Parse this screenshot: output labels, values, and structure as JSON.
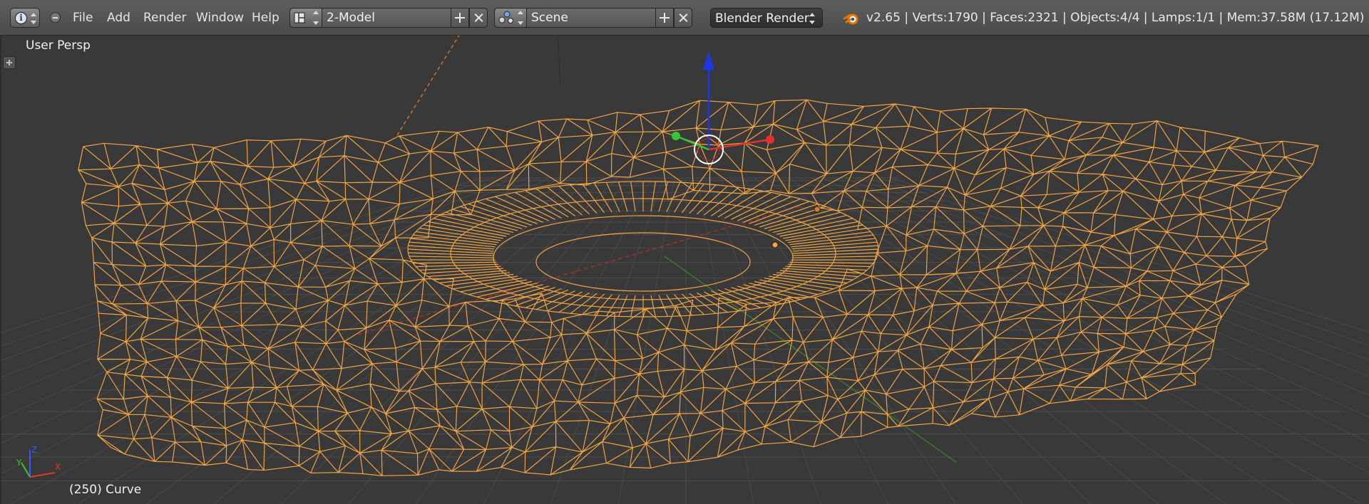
{
  "header": {
    "menus": [
      "File",
      "Add",
      "Render",
      "Window",
      "Help"
    ],
    "screen_layout": "2-Model",
    "scene": "Scene",
    "render_engine": "Blender Render",
    "stats": "v2.65 | Verts:1790 | Faces:2321 | Objects:4/4 | Lamps:1/1 | Mem:37.58M (17.12M) | Curve"
  },
  "viewport": {
    "view_name": "User Persp",
    "object_info": "(250) Curve",
    "axis_labels": {
      "x": "X",
      "y": "Y",
      "z": "Z"
    }
  },
  "icons": {
    "editor_type": "info-icon",
    "collapse": "collapse-menus-icon",
    "screen_layout": "screen-layout-icon",
    "scene": "scene-icon",
    "stats": "blender-logo-icon"
  },
  "colors": {
    "viewport_bg": "#393939",
    "header_bg": "#545454",
    "wire_selected": "#f5a745",
    "axis_x": "#e0382c",
    "axis_y": "#3cc43c",
    "axis_z": "#2040e8"
  }
}
